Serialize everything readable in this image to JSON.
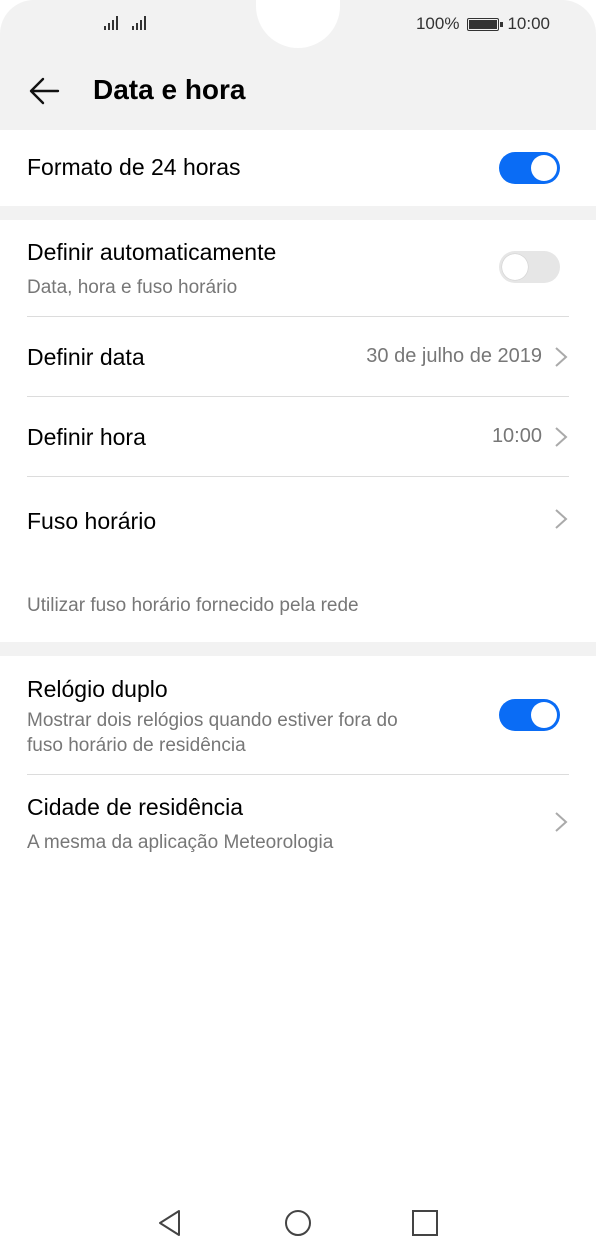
{
  "status": {
    "battery": "100%",
    "time": "10:00"
  },
  "header": {
    "title": "Data e hora"
  },
  "items": {
    "format24": {
      "title": "Formato de 24 horas",
      "enabled": true
    },
    "auto": {
      "title": "Definir automaticamente",
      "subtitle": "Data, hora e fuso horário",
      "enabled": false
    },
    "date": {
      "title": "Definir data",
      "value": "30 de julho de 2019"
    },
    "time": {
      "title": "Definir hora",
      "value": "10:00"
    },
    "timezone": {
      "title": "Fuso horário"
    },
    "network_note": "Utilizar fuso horário fornecido pela rede",
    "dual_clock": {
      "title": "Relógio duplo",
      "subtitle_line1": "Mostrar dois relógios quando estiver fora do",
      "subtitle_line2": "fuso horário de residência",
      "enabled": true
    },
    "home_city": {
      "title": "Cidade de residência",
      "subtitle": "A mesma da aplicação Meteorologia"
    }
  },
  "colors": {
    "accent": "#0a6cf5",
    "background": "#f2f2f2",
    "secondary_text": "#777777"
  },
  "icons": [
    "back-arrow-icon",
    "chevron-right-icon",
    "nav-back-icon",
    "nav-home-icon",
    "nav-recents-icon",
    "signal-icon",
    "battery-icon"
  ]
}
